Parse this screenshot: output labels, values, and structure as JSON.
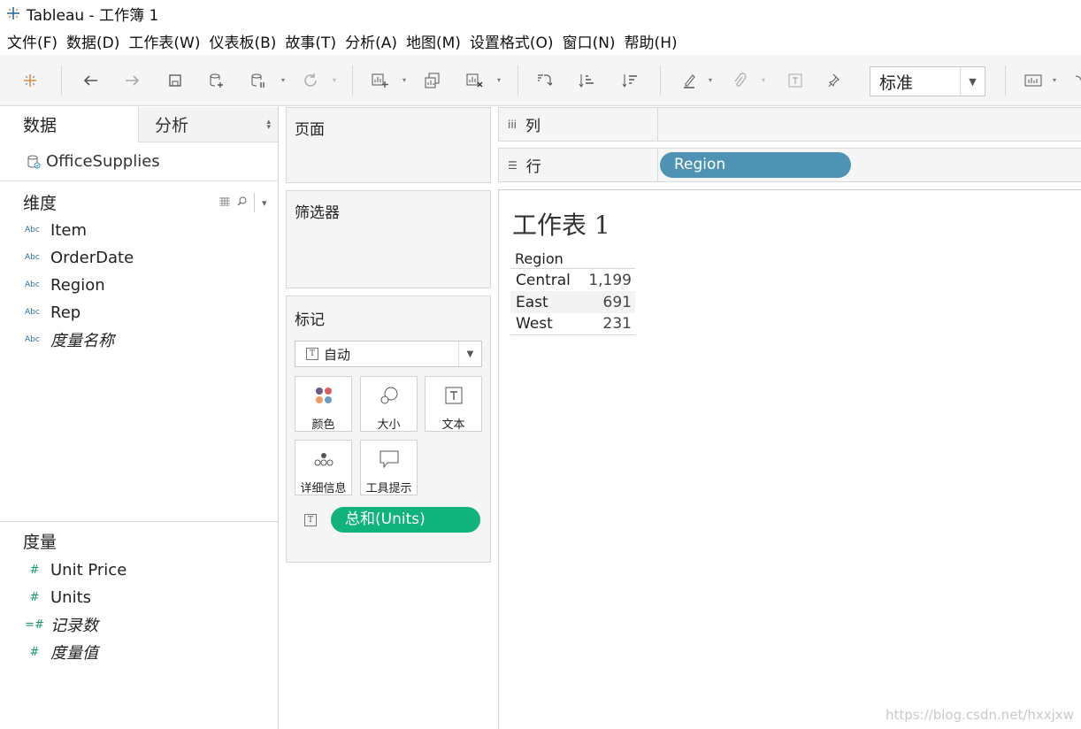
{
  "window": {
    "title": "Tableau - 工作簿 1"
  },
  "menu": [
    "文件(F)",
    "数据(D)",
    "工作表(W)",
    "仪表板(B)",
    "故事(T)",
    "分析(A)",
    "地图(M)",
    "设置格式(O)",
    "窗口(N)",
    "帮助(H)"
  ],
  "toolbar": {
    "fit_value": "标准"
  },
  "data_pane": {
    "tab_data": "数据",
    "tab_analysis": "分析",
    "datasource": "OfficeSupplies",
    "dimensions_title": "维度",
    "dimensions": [
      {
        "type": "Abc",
        "name": "Item"
      },
      {
        "type": "Abc",
        "name": "OrderDate"
      },
      {
        "type": "Abc",
        "name": "Region"
      },
      {
        "type": "Abc",
        "name": "Rep"
      },
      {
        "type": "Abc",
        "name": "度量名称"
      }
    ],
    "measures_title": "度量",
    "measures": [
      {
        "type": "#",
        "name": "Unit Price"
      },
      {
        "type": "#",
        "name": "Units"
      },
      {
        "type": "=#",
        "name": "记录数"
      },
      {
        "type": "#",
        "name": "度量值"
      }
    ]
  },
  "cards": {
    "pages_title": "页面",
    "filters_title": "筛选器",
    "marks_title": "标记",
    "marks_type": "自动",
    "mark_buttons": [
      "颜色",
      "大小",
      "文本",
      "详细信息",
      "工具提示"
    ],
    "text_pill": "总和(Units)"
  },
  "shelves": {
    "columns_label": "列",
    "rows_label": "行",
    "rows_pill": "Region"
  },
  "view": {
    "sheet_title": "工作表 1",
    "table_header": "Region",
    "rows": [
      {
        "region": "Central",
        "value": "1,199"
      },
      {
        "region": "East",
        "value": "691"
      },
      {
        "region": "West",
        "value": "231"
      }
    ]
  },
  "watermark": "https://blog.csdn.net/hxxjxw",
  "colors": {
    "dimension_pill": "#4e93b3",
    "measure_pill": "#10b37b"
  }
}
